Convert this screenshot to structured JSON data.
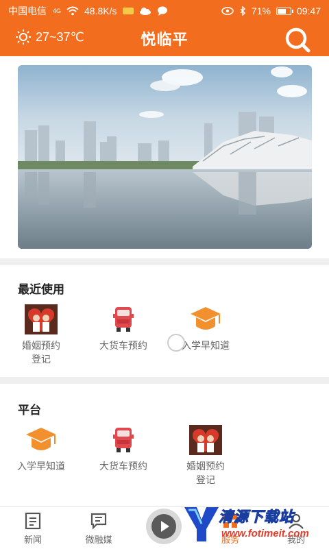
{
  "status_bar": {
    "carrier": "中国电信",
    "signal_type": "4G",
    "speed": "48.8K/s",
    "battery": "71%",
    "battery_level": 0.71,
    "time": "09:47"
  },
  "header": {
    "weather": "27~37℃",
    "title": "悦临平",
    "search_icon": "search-icon",
    "weather_icon": "sun-icon"
  },
  "recent": {
    "title": "最近使用",
    "items": [
      {
        "label": "婚姻预约登记",
        "icon": "marriage-icon"
      },
      {
        "label": "大货车预约",
        "icon": "truck-icon"
      },
      {
        "label": "入学早知道",
        "icon": "graduation-cap-icon"
      }
    ]
  },
  "platform": {
    "title": "平台",
    "items": [
      {
        "label": "入学早知道",
        "icon": "graduation-cap-icon"
      },
      {
        "label": "大货车预约",
        "icon": "truck-icon"
      },
      {
        "label": "婚姻预约登记",
        "icon": "marriage-icon"
      }
    ]
  },
  "tabbar": {
    "tabs": [
      {
        "label": "新闻",
        "icon": "news-icon"
      },
      {
        "label": "微融媒",
        "icon": "chat-icon"
      },
      {
        "label": "服务",
        "icon": "service-icon",
        "active": true
      },
      {
        "label": "我的",
        "icon": "user-icon"
      }
    ]
  },
  "watermark": {
    "text": "清源下载站",
    "url": "www.fotimeit.com"
  },
  "colors": {
    "brand": "#f36d1e",
    "divider": "#efefef",
    "text_secondary": "#666666"
  }
}
